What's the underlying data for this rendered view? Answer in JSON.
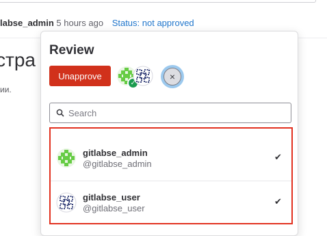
{
  "meta": {
    "author": "labse_admin",
    "time": "5 hours ago",
    "status": "Status: not approved"
  },
  "background": {
    "heading": "стра",
    "text": "ии."
  },
  "review": {
    "title": "Review",
    "unapprove_label": "Unapprove",
    "close_symbol": "×",
    "search_placeholder": "Search",
    "users": [
      {
        "name": "gitlabse_admin",
        "handle": "@gitlabse_admin",
        "avatar": "green-identicon",
        "selected": "✔"
      },
      {
        "name": "gitlabse_user",
        "handle": "@gitlabse_user",
        "avatar": "navy-identicon",
        "selected": "✔"
      }
    ]
  },
  "colors": {
    "accent_blue": "#1f75cb",
    "danger_red": "#d1311b",
    "highlight_red": "#e2301e",
    "avatar_green": "#66cc44",
    "avatar_navy": "#24306e"
  }
}
